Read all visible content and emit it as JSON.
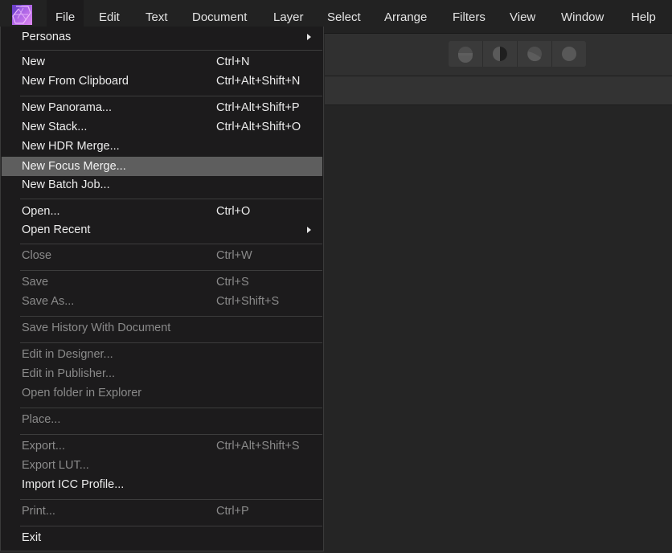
{
  "app": {
    "name": "Affinity Photo",
    "logo_icon": "affinity-photo-logo",
    "accent": "#b66ae8"
  },
  "menubar": {
    "items": [
      {
        "label": "File",
        "active": true
      },
      {
        "label": "Edit"
      },
      {
        "label": "Text"
      },
      {
        "label": "Document"
      },
      {
        "label": "Layer"
      },
      {
        "label": "Select"
      },
      {
        "label": "Arrange"
      },
      {
        "label": "Filters"
      },
      {
        "label": "View"
      },
      {
        "label": "Window"
      },
      {
        "label": "Help"
      }
    ]
  },
  "toolbar": {
    "personas": [
      {
        "name": "photo-persona",
        "icon": "photo-persona-icon"
      },
      {
        "name": "liquify-persona",
        "icon": "liquify-persona-icon"
      },
      {
        "name": "develop-persona",
        "icon": "develop-persona-icon"
      },
      {
        "name": "tone-mapping-persona",
        "icon": "tone-mapping-persona-icon"
      }
    ]
  },
  "file_menu": {
    "items": [
      {
        "label": "Personas",
        "shortcut": "",
        "submenu": true,
        "enabled": true
      },
      {
        "label": "New",
        "shortcut": "Ctrl+N",
        "enabled": true
      },
      {
        "label": "New From Clipboard",
        "shortcut": "Ctrl+Alt+Shift+N",
        "enabled": true
      },
      {
        "label": "New Panorama...",
        "shortcut": "Ctrl+Alt+Shift+P",
        "enabled": true
      },
      {
        "label": "New Stack...",
        "shortcut": "Ctrl+Alt+Shift+O",
        "enabled": true
      },
      {
        "label": "New HDR Merge...",
        "shortcut": "",
        "enabled": true
      },
      {
        "label": "New Focus Merge...",
        "shortcut": "",
        "enabled": true,
        "highlighted": true
      },
      {
        "label": "New Batch Job...",
        "shortcut": "",
        "enabled": true
      },
      {
        "label": "Open...",
        "shortcut": "Ctrl+O",
        "enabled": true
      },
      {
        "label": "Open Recent",
        "shortcut": "",
        "submenu": true,
        "enabled": true
      },
      {
        "label": "Close",
        "shortcut": "Ctrl+W",
        "enabled": false
      },
      {
        "label": "Save",
        "shortcut": "Ctrl+S",
        "enabled": false
      },
      {
        "label": "Save As...",
        "shortcut": "Ctrl+Shift+S",
        "enabled": false
      },
      {
        "label": "Save History With Document",
        "shortcut": "",
        "enabled": false
      },
      {
        "label": "Edit in Designer...",
        "shortcut": "",
        "enabled": false
      },
      {
        "label": "Edit in Publisher...",
        "shortcut": "",
        "enabled": false
      },
      {
        "label": "Open folder in Explorer",
        "shortcut": "",
        "enabled": false
      },
      {
        "label": "Place...",
        "shortcut": "",
        "enabled": false
      },
      {
        "label": "Export...",
        "shortcut": "Ctrl+Alt+Shift+S",
        "enabled": false
      },
      {
        "label": "Export LUT...",
        "shortcut": "",
        "enabled": false
      },
      {
        "label": "Import ICC Profile...",
        "shortcut": "",
        "enabled": true
      },
      {
        "label": "Print...",
        "shortcut": "Ctrl+P",
        "enabled": false
      },
      {
        "label": "Exit",
        "shortcut": "",
        "enabled": true
      }
    ]
  }
}
